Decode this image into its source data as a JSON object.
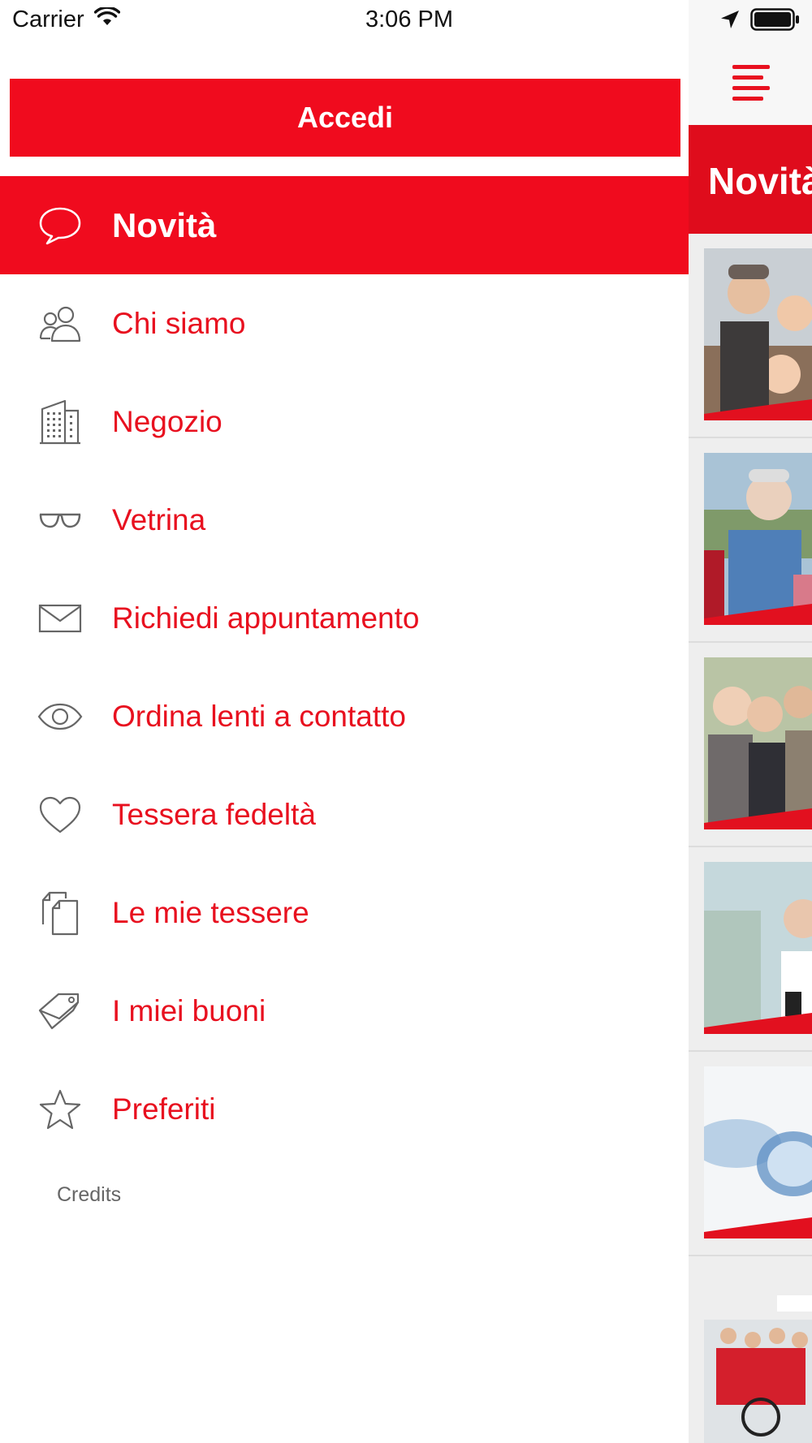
{
  "status_bar": {
    "carrier": "Carrier",
    "time": "3:06 PM",
    "icons": [
      "wifi-icon",
      "location-arrow-icon",
      "battery-icon"
    ]
  },
  "drawer": {
    "login_label": "Accedi",
    "menu": [
      {
        "label": "Novità",
        "icon": "speech-bubble-icon",
        "active": true
      },
      {
        "label": "Chi siamo",
        "icon": "people-icon",
        "active": false
      },
      {
        "label": "Negozio",
        "icon": "building-icon",
        "active": false
      },
      {
        "label": "Vetrina",
        "icon": "glasses-icon",
        "active": false
      },
      {
        "label": "Richiedi appuntamento",
        "icon": "envelope-icon",
        "active": false
      },
      {
        "label": "Ordina lenti a contatto",
        "icon": "eye-icon",
        "active": false
      },
      {
        "label": "Tessera fedeltà",
        "icon": "heart-icon",
        "active": false
      },
      {
        "label": "Le mie tessere",
        "icon": "cards-icon",
        "active": false
      },
      {
        "label": "I miei buoni",
        "icon": "tags-icon",
        "active": false
      },
      {
        "label": "Preferiti",
        "icon": "star-icon",
        "active": false
      }
    ],
    "credits_label": "Credits"
  },
  "content": {
    "menu_icon": "hamburger-menu-icon",
    "header_title": "Novità",
    "news_thumbnails": [
      "family-photo",
      "hikers-photo",
      "friends-photo",
      "optician-photo",
      "contact-lenses-photo",
      "shop-team-photo"
    ]
  },
  "colors": {
    "accent": "#f00b1e",
    "text_accent": "#e8101f",
    "icon_gray": "#666666"
  }
}
